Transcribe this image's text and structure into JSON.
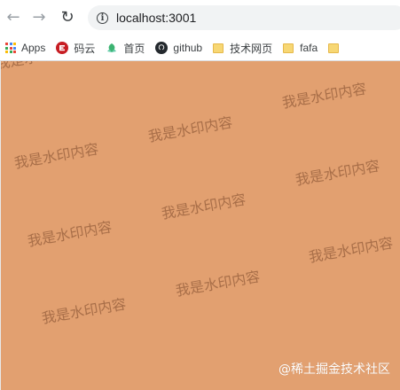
{
  "browser": {
    "url": "localhost:3001"
  },
  "bookmarks": [
    {
      "label": "Apps",
      "icon": "apps-grid-icon"
    },
    {
      "label": "码云",
      "icon": "gitee-icon",
      "color": "#c71d23"
    },
    {
      "label": "首页",
      "icon": "leaf-icon",
      "color": "#3cb371"
    },
    {
      "label": "github",
      "icon": "github-icon",
      "color": "#24292e"
    },
    {
      "label": "技术网页",
      "icon": "folder-icon"
    },
    {
      "label": "fafa",
      "icon": "folder-icon"
    }
  ],
  "page": {
    "background": "#e2a070",
    "watermark_text": "我是水印内容",
    "credit": "@稀土掘金技术社区"
  }
}
